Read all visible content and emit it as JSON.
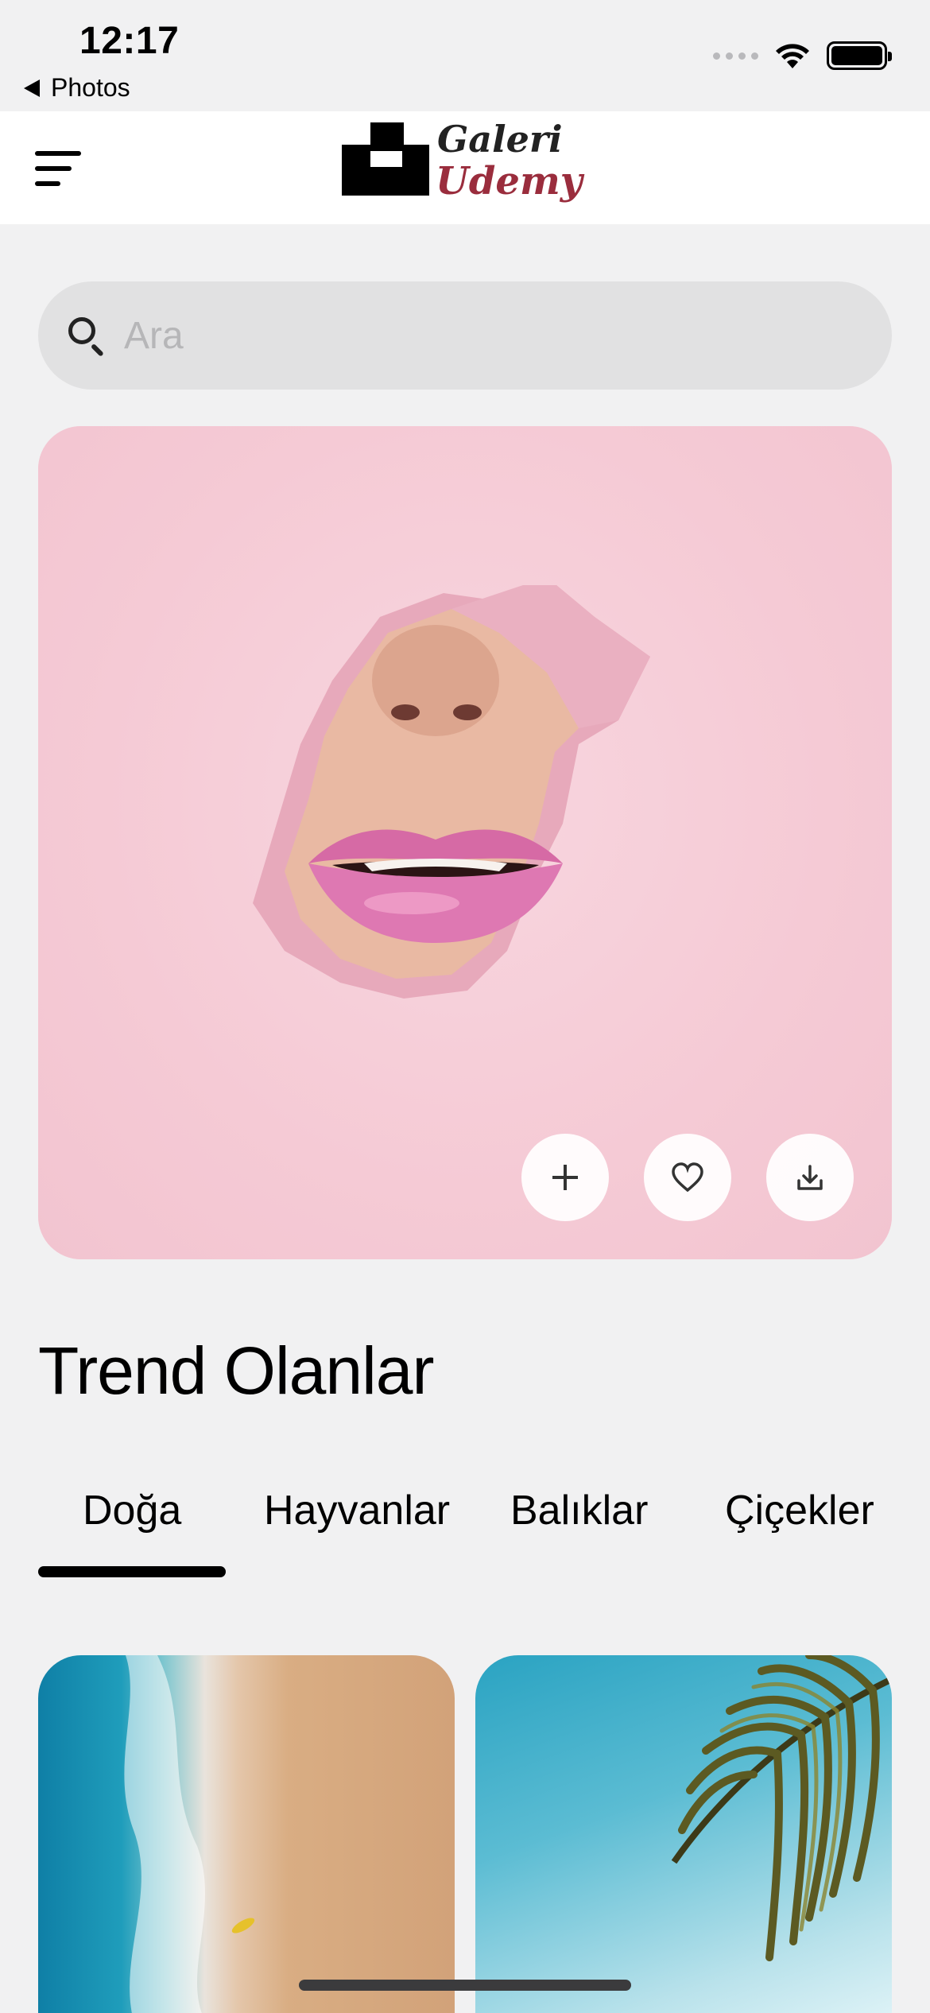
{
  "status_bar": {
    "time": "12:17",
    "back_app_label": "Photos"
  },
  "header": {
    "logo_text_top": "Galeri",
    "logo_text_bottom": "Udemy",
    "logo_colors": {
      "dark": "#222222",
      "accent": "#9a2d3d"
    }
  },
  "search": {
    "placeholder": "Ara",
    "value": ""
  },
  "hero": {
    "actions": [
      {
        "icon": "plus-icon"
      },
      {
        "icon": "heart-icon"
      },
      {
        "icon": "download-icon"
      }
    ],
    "background_color": "#f6cdd8"
  },
  "trending": {
    "title": "Trend Olanlar",
    "tabs": [
      {
        "label": "Doğa",
        "active": true
      },
      {
        "label": "Hayvanlar",
        "active": false
      },
      {
        "label": "Balıklar",
        "active": false
      },
      {
        "label": "Çiçekler",
        "active": false
      }
    ]
  },
  "gallery": {
    "tiles": [
      {
        "subject": "beach-aerial"
      },
      {
        "subject": "palm-leaf"
      }
    ]
  }
}
